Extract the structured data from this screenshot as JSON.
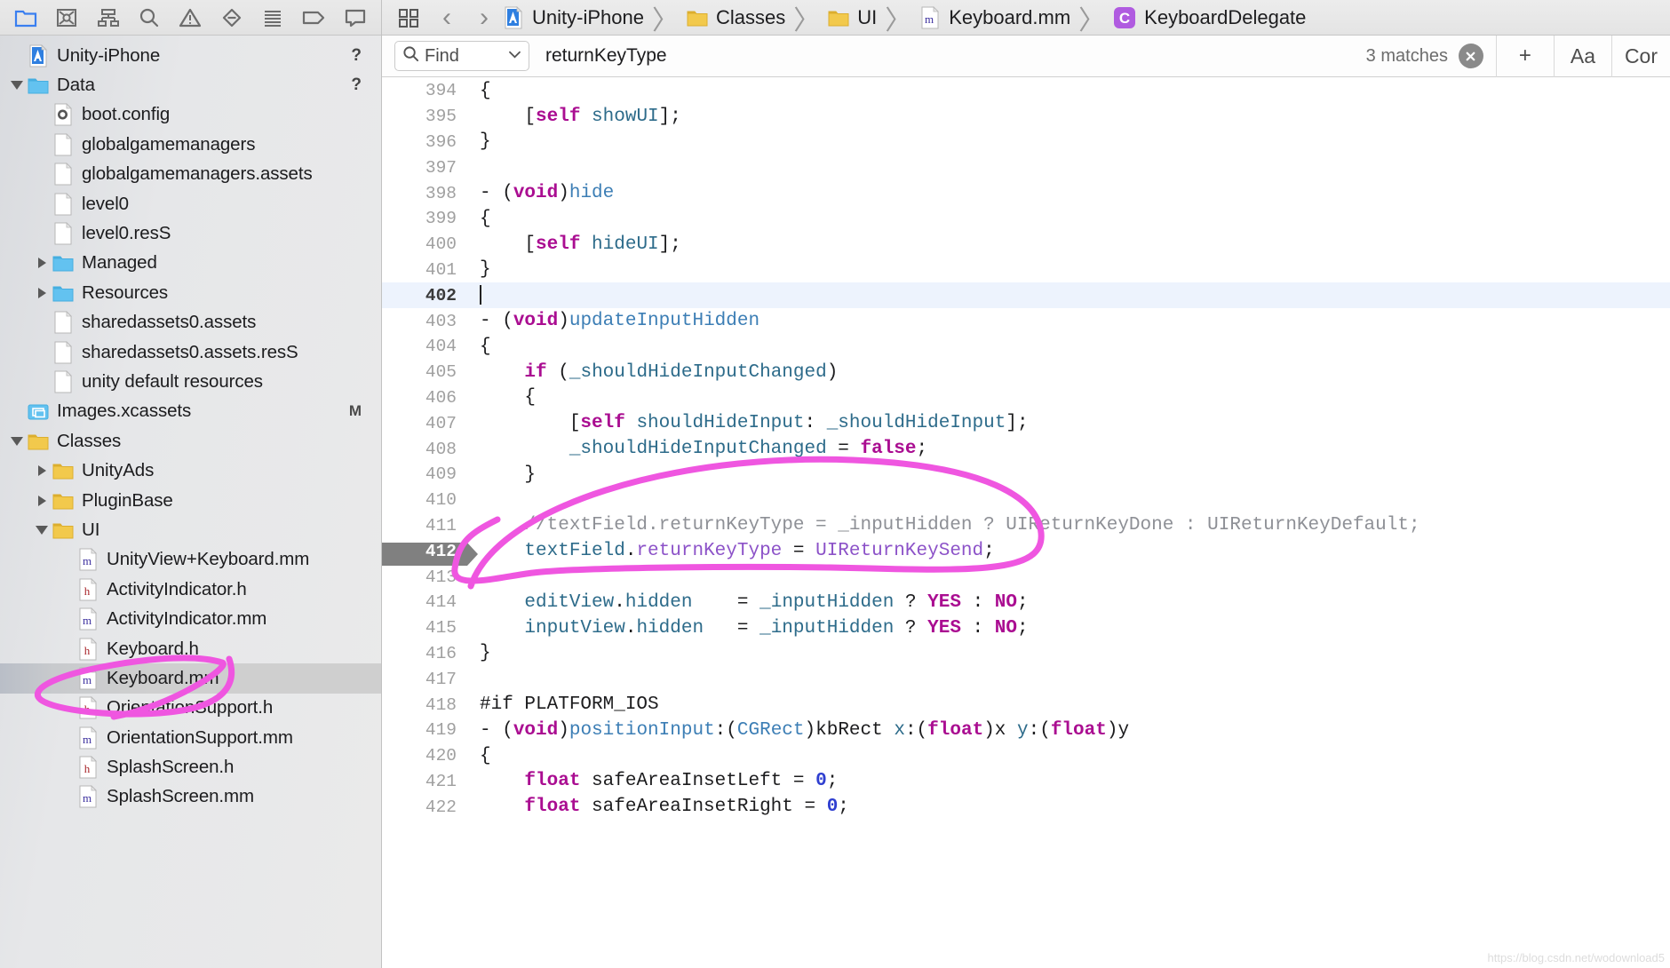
{
  "navigator_toolbar": {
    "buttons": [
      {
        "name": "project-navigator-icon",
        "label": "Project Navigator",
        "active": true
      },
      {
        "name": "source-control-navigator-icon",
        "label": "Source Control Navigator",
        "active": false
      },
      {
        "name": "symbol-navigator-icon",
        "label": "Symbol Navigator",
        "active": false
      },
      {
        "name": "find-navigator-icon",
        "label": "Find Navigator",
        "active": false
      },
      {
        "name": "issue-navigator-icon",
        "label": "Issue Navigator",
        "active": false
      },
      {
        "name": "test-navigator-icon",
        "label": "Test Navigator",
        "active": false
      },
      {
        "name": "debug-navigator-icon",
        "label": "Debug Navigator",
        "active": false
      },
      {
        "name": "breakpoint-navigator-icon",
        "label": "Breakpoint Navigator",
        "active": false
      },
      {
        "name": "report-navigator-icon",
        "label": "Report Navigator",
        "active": false
      }
    ]
  },
  "sidebar": {
    "items": [
      {
        "label": "Unity-iPhone",
        "icon": "xcode-project-icon",
        "indent": 0,
        "twisty": "none",
        "status": "?",
        "selected": false
      },
      {
        "label": "Data",
        "icon": "blue-folder-icon",
        "indent": 0,
        "twisty": "open",
        "status": "?",
        "selected": false
      },
      {
        "label": "boot.config",
        "icon": "gear-file-icon",
        "indent": 1,
        "twisty": "none",
        "status": "",
        "selected": false
      },
      {
        "label": "globalgamemanagers",
        "icon": "plain-file-icon",
        "indent": 1,
        "twisty": "none",
        "status": "",
        "selected": false
      },
      {
        "label": "globalgamemanagers.assets",
        "icon": "plain-file-icon",
        "indent": 1,
        "twisty": "none",
        "status": "",
        "selected": false
      },
      {
        "label": "level0",
        "icon": "plain-file-icon",
        "indent": 1,
        "twisty": "none",
        "status": "",
        "selected": false
      },
      {
        "label": "level0.resS",
        "icon": "plain-file-icon",
        "indent": 1,
        "twisty": "none",
        "status": "",
        "selected": false
      },
      {
        "label": "Managed",
        "icon": "blue-folder-icon",
        "indent": 1,
        "twisty": "closed",
        "status": "",
        "selected": false
      },
      {
        "label": "Resources",
        "icon": "blue-folder-icon",
        "indent": 1,
        "twisty": "closed",
        "status": "",
        "selected": false
      },
      {
        "label": "sharedassets0.assets",
        "icon": "plain-file-icon",
        "indent": 1,
        "twisty": "none",
        "status": "",
        "selected": false
      },
      {
        "label": "sharedassets0.assets.resS",
        "icon": "plain-file-icon",
        "indent": 1,
        "twisty": "none",
        "status": "",
        "selected": false
      },
      {
        "label": "unity default resources",
        "icon": "plain-file-icon",
        "indent": 1,
        "twisty": "none",
        "status": "",
        "selected": false
      },
      {
        "label": "Images.xcassets",
        "icon": "xcassets-icon",
        "indent": 0,
        "twisty": "none",
        "status": "M",
        "selected": false
      },
      {
        "label": "Classes",
        "icon": "yellow-folder-icon",
        "indent": 0,
        "twisty": "open",
        "status": "",
        "selected": false
      },
      {
        "label": "UnityAds",
        "icon": "yellow-folder-icon",
        "indent": 1,
        "twisty": "closed",
        "status": "",
        "selected": false
      },
      {
        "label": "PluginBase",
        "icon": "yellow-folder-icon",
        "indent": 1,
        "twisty": "closed",
        "status": "",
        "selected": false
      },
      {
        "label": "UI",
        "icon": "yellow-folder-icon",
        "indent": 1,
        "twisty": "open",
        "status": "",
        "selected": false
      },
      {
        "label": "UnityView+Keyboard.mm",
        "icon": "m-file-icon",
        "indent": 2,
        "twisty": "none",
        "status": "",
        "selected": false
      },
      {
        "label": "ActivityIndicator.h",
        "icon": "h-file-icon",
        "indent": 2,
        "twisty": "none",
        "status": "",
        "selected": false
      },
      {
        "label": "ActivityIndicator.mm",
        "icon": "m-file-icon",
        "indent": 2,
        "twisty": "none",
        "status": "",
        "selected": false
      },
      {
        "label": "Keyboard.h",
        "icon": "h-file-icon",
        "indent": 2,
        "twisty": "none",
        "status": "",
        "selected": false
      },
      {
        "label": "Keyboard.mm",
        "icon": "m-file-icon",
        "indent": 2,
        "twisty": "none",
        "status": "",
        "selected": true
      },
      {
        "label": "OrientationSupport.h",
        "icon": "h-file-icon",
        "indent": 2,
        "twisty": "none",
        "status": "",
        "selected": false
      },
      {
        "label": "OrientationSupport.mm",
        "icon": "m-file-icon",
        "indent": 2,
        "twisty": "none",
        "status": "",
        "selected": false
      },
      {
        "label": "SplashScreen.h",
        "icon": "h-file-icon",
        "indent": 2,
        "twisty": "none",
        "status": "",
        "selected": false
      },
      {
        "label": "SplashScreen.mm",
        "icon": "m-file-icon",
        "indent": 2,
        "twisty": "none",
        "status": "",
        "selected": false
      }
    ]
  },
  "breadcrumb": {
    "back_label": "‹",
    "forward_label": "›",
    "crumbs": [
      {
        "label": "Unity-iPhone",
        "icon": "xcode-project-icon"
      },
      {
        "label": "Classes",
        "icon": "yellow-folder-icon"
      },
      {
        "label": "UI",
        "icon": "yellow-folder-icon"
      },
      {
        "label": "Keyboard.mm",
        "icon": "m-file-icon"
      },
      {
        "label": "KeyboardDelegate",
        "icon": "class-badge-icon"
      }
    ],
    "separator": "〉"
  },
  "find_bar": {
    "scope_label": "Find",
    "scope_icon": "search-icon",
    "chevron_icon": "chevron-down-icon",
    "query": "returnKeyType",
    "placeholder": "Search",
    "matches_label": "3 matches",
    "clear_icon": "clear-circle-icon",
    "add_label": "+",
    "case_label": "Aa",
    "mode_label": "Cor"
  },
  "editor": {
    "current_line": 402,
    "selected_line": 412,
    "lines": [
      {
        "n": 394,
        "tokens": [
          {
            "t": "{",
            "c": "pre"
          }
        ]
      },
      {
        "n": 395,
        "tokens": [
          {
            "t": "    [",
            "c": "pre"
          },
          {
            "t": "self",
            "c": "kw"
          },
          {
            "t": " ",
            "c": "pre"
          },
          {
            "t": "showUI",
            "c": "fn"
          },
          {
            "t": "];",
            "c": "pre"
          }
        ]
      },
      {
        "n": 396,
        "tokens": [
          {
            "t": "}",
            "c": "pre"
          }
        ]
      },
      {
        "n": 397,
        "tokens": [
          {
            "t": "",
            "c": "pre"
          }
        ]
      },
      {
        "n": 398,
        "tokens": [
          {
            "t": "- (",
            "c": "pre"
          },
          {
            "t": "void",
            "c": "kw"
          },
          {
            "t": ")",
            "c": "pre"
          },
          {
            "t": "hide",
            "c": "blue"
          }
        ]
      },
      {
        "n": 399,
        "tokens": [
          {
            "t": "{",
            "c": "pre"
          }
        ]
      },
      {
        "n": 400,
        "tokens": [
          {
            "t": "    [",
            "c": "pre"
          },
          {
            "t": "self",
            "c": "kw"
          },
          {
            "t": " ",
            "c": "pre"
          },
          {
            "t": "hideUI",
            "c": "fn"
          },
          {
            "t": "];",
            "c": "pre"
          }
        ]
      },
      {
        "n": 401,
        "tokens": [
          {
            "t": "}",
            "c": "pre"
          }
        ]
      },
      {
        "n": 402,
        "tokens": [
          {
            "t": "",
            "c": "pre"
          }
        ],
        "cursor": true
      },
      {
        "n": 403,
        "tokens": [
          {
            "t": "- (",
            "c": "pre"
          },
          {
            "t": "void",
            "c": "kw"
          },
          {
            "t": ")",
            "c": "pre"
          },
          {
            "t": "updateInputHidden",
            "c": "blue"
          }
        ]
      },
      {
        "n": 404,
        "tokens": [
          {
            "t": "{",
            "c": "pre"
          }
        ]
      },
      {
        "n": 405,
        "tokens": [
          {
            "t": "    ",
            "c": "pre"
          },
          {
            "t": "if",
            "c": "kw"
          },
          {
            "t": " (",
            "c": "pre"
          },
          {
            "t": "_shouldHideInputChanged",
            "c": "fn"
          },
          {
            "t": ")",
            "c": "pre"
          }
        ]
      },
      {
        "n": 406,
        "tokens": [
          {
            "t": "    {",
            "c": "pre"
          }
        ]
      },
      {
        "n": 407,
        "tokens": [
          {
            "t": "        [",
            "c": "pre"
          },
          {
            "t": "self",
            "c": "kw"
          },
          {
            "t": " ",
            "c": "pre"
          },
          {
            "t": "shouldHideInput",
            "c": "fn"
          },
          {
            "t": ": ",
            "c": "pre"
          },
          {
            "t": "_shouldHideInput",
            "c": "fn"
          },
          {
            "t": "];",
            "c": "pre"
          }
        ]
      },
      {
        "n": 408,
        "tokens": [
          {
            "t": "        ",
            "c": "pre"
          },
          {
            "t": "_shouldHideInputChanged",
            "c": "fn"
          },
          {
            "t": " = ",
            "c": "pre"
          },
          {
            "t": "false",
            "c": "kw"
          },
          {
            "t": ";",
            "c": "pre"
          }
        ]
      },
      {
        "n": 409,
        "tokens": [
          {
            "t": "    }",
            "c": "pre"
          }
        ]
      },
      {
        "n": 410,
        "tokens": [
          {
            "t": "",
            "c": "pre"
          }
        ]
      },
      {
        "n": 411,
        "tokens": [
          {
            "t": "    //textField.returnKeyType = _inputHidden ? UIReturnKeyDone : UIReturnKeyDefault;",
            "c": "cmt"
          }
        ]
      },
      {
        "n": 412,
        "tokens": [
          {
            "t": "    ",
            "c": "pre"
          },
          {
            "t": "textField",
            "c": "fn"
          },
          {
            "t": ".",
            "c": "pre"
          },
          {
            "t": "returnKeyType",
            "c": "prop"
          },
          {
            "t": " = ",
            "c": "pre"
          },
          {
            "t": "UIReturnKeySend",
            "c": "prop"
          },
          {
            "t": ";",
            "c": "pre"
          }
        ]
      },
      {
        "n": 413,
        "tokens": [
          {
            "t": "",
            "c": "pre"
          }
        ]
      },
      {
        "n": 414,
        "tokens": [
          {
            "t": "    ",
            "c": "pre"
          },
          {
            "t": "editView",
            "c": "fn"
          },
          {
            "t": ".",
            "c": "pre"
          },
          {
            "t": "hidden",
            "c": "fn"
          },
          {
            "t": "    = ",
            "c": "pre"
          },
          {
            "t": "_inputHidden",
            "c": "fn"
          },
          {
            "t": " ? ",
            "c": "pre"
          },
          {
            "t": "YES",
            "c": "kw"
          },
          {
            "t": " : ",
            "c": "pre"
          },
          {
            "t": "NO",
            "c": "kw"
          },
          {
            "t": ";",
            "c": "pre"
          }
        ]
      },
      {
        "n": 415,
        "tokens": [
          {
            "t": "    ",
            "c": "pre"
          },
          {
            "t": "inputView",
            "c": "fn"
          },
          {
            "t": ".",
            "c": "pre"
          },
          {
            "t": "hidden",
            "c": "fn"
          },
          {
            "t": "   = ",
            "c": "pre"
          },
          {
            "t": "_inputHidden",
            "c": "fn"
          },
          {
            "t": " ? ",
            "c": "pre"
          },
          {
            "t": "YES",
            "c": "kw"
          },
          {
            "t": " : ",
            "c": "pre"
          },
          {
            "t": "NO",
            "c": "kw"
          },
          {
            "t": ";",
            "c": "pre"
          }
        ]
      },
      {
        "n": 416,
        "tokens": [
          {
            "t": "}",
            "c": "pre"
          }
        ]
      },
      {
        "n": 417,
        "tokens": [
          {
            "t": "",
            "c": "pre"
          }
        ]
      },
      {
        "n": 418,
        "tokens": [
          {
            "t": "#if PLATFORM_IOS",
            "c": "pre"
          }
        ]
      },
      {
        "n": 419,
        "tokens": [
          {
            "t": "- (",
            "c": "pre"
          },
          {
            "t": "void",
            "c": "kw"
          },
          {
            "t": ")",
            "c": "pre"
          },
          {
            "t": "positionInput",
            "c": "blue"
          },
          {
            "t": ":(",
            "c": "pre"
          },
          {
            "t": "CGRect",
            "c": "blue"
          },
          {
            "t": ")kbRect ",
            "c": "pre"
          },
          {
            "t": "x",
            "c": "fn"
          },
          {
            "t": ":(",
            "c": "pre"
          },
          {
            "t": "float",
            "c": "kw"
          },
          {
            "t": ")x ",
            "c": "pre"
          },
          {
            "t": "y",
            "c": "fn"
          },
          {
            "t": ":(",
            "c": "pre"
          },
          {
            "t": "float",
            "c": "kw"
          },
          {
            "t": ")y",
            "c": "pre"
          }
        ]
      },
      {
        "n": 420,
        "tokens": [
          {
            "t": "{",
            "c": "pre"
          }
        ]
      },
      {
        "n": 421,
        "tokens": [
          {
            "t": "    ",
            "c": "pre"
          },
          {
            "t": "float",
            "c": "kw"
          },
          {
            "t": " safeAreaInsetLeft = ",
            "c": "pre"
          },
          {
            "t": "0",
            "c": "num"
          },
          {
            "t": ";",
            "c": "pre"
          }
        ]
      },
      {
        "n": 422,
        "tokens": [
          {
            "t": "    ",
            "c": "pre"
          },
          {
            "t": "float",
            "c": "kw"
          },
          {
            "t": " safeAreaInsetRight = ",
            "c": "pre"
          },
          {
            "t": "0",
            "c": "num"
          },
          {
            "t": ";",
            "c": "pre"
          }
        ]
      }
    ]
  },
  "annotations": {
    "color": "#ef56e0",
    "shapes": [
      "code-circle-411-413",
      "sidebar-circle-keyboard-mm"
    ]
  },
  "watermark": {
    "text": "https://blog.csdn.net/wodownload5"
  },
  "colors": {
    "accent_blue": "#3a7ff0",
    "annotation_pink": "#ef56e0",
    "selection_gray": "#cfcfcf",
    "current_line_blue": "#edf3fd",
    "keyword_magenta": "#aa0d91",
    "identifier_teal": "#2d6b8a",
    "property_purple": "#8c52c8",
    "comment_gray": "#8e9096"
  }
}
